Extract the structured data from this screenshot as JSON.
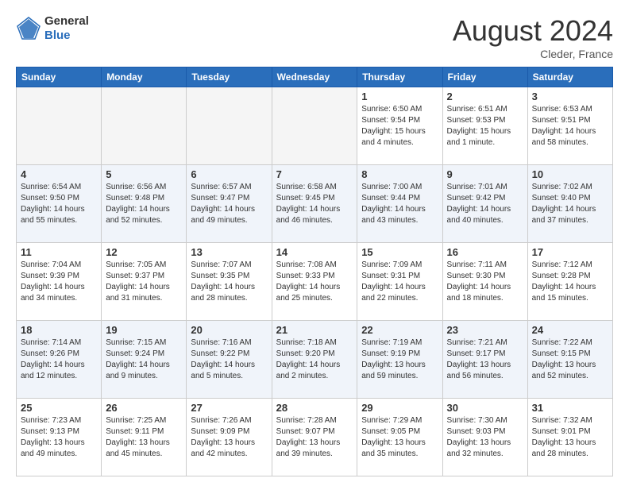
{
  "logo": {
    "general": "General",
    "blue": "Blue"
  },
  "title": "August 2024",
  "location": "Cleder, France",
  "days_of_week": [
    "Sunday",
    "Monday",
    "Tuesday",
    "Wednesday",
    "Thursday",
    "Friday",
    "Saturday"
  ],
  "weeks": [
    [
      {
        "day": "",
        "info": ""
      },
      {
        "day": "",
        "info": ""
      },
      {
        "day": "",
        "info": ""
      },
      {
        "day": "",
        "info": ""
      },
      {
        "day": "1",
        "info": "Sunrise: 6:50 AM\nSunset: 9:54 PM\nDaylight: 15 hours and 4 minutes."
      },
      {
        "day": "2",
        "info": "Sunrise: 6:51 AM\nSunset: 9:53 PM\nDaylight: 15 hours and 1 minute."
      },
      {
        "day": "3",
        "info": "Sunrise: 6:53 AM\nSunset: 9:51 PM\nDaylight: 14 hours and 58 minutes."
      }
    ],
    [
      {
        "day": "4",
        "info": "Sunrise: 6:54 AM\nSunset: 9:50 PM\nDaylight: 14 hours and 55 minutes."
      },
      {
        "day": "5",
        "info": "Sunrise: 6:56 AM\nSunset: 9:48 PM\nDaylight: 14 hours and 52 minutes."
      },
      {
        "day": "6",
        "info": "Sunrise: 6:57 AM\nSunset: 9:47 PM\nDaylight: 14 hours and 49 minutes."
      },
      {
        "day": "7",
        "info": "Sunrise: 6:58 AM\nSunset: 9:45 PM\nDaylight: 14 hours and 46 minutes."
      },
      {
        "day": "8",
        "info": "Sunrise: 7:00 AM\nSunset: 9:44 PM\nDaylight: 14 hours and 43 minutes."
      },
      {
        "day": "9",
        "info": "Sunrise: 7:01 AM\nSunset: 9:42 PM\nDaylight: 14 hours and 40 minutes."
      },
      {
        "day": "10",
        "info": "Sunrise: 7:02 AM\nSunset: 9:40 PM\nDaylight: 14 hours and 37 minutes."
      }
    ],
    [
      {
        "day": "11",
        "info": "Sunrise: 7:04 AM\nSunset: 9:39 PM\nDaylight: 14 hours and 34 minutes."
      },
      {
        "day": "12",
        "info": "Sunrise: 7:05 AM\nSunset: 9:37 PM\nDaylight: 14 hours and 31 minutes."
      },
      {
        "day": "13",
        "info": "Sunrise: 7:07 AM\nSunset: 9:35 PM\nDaylight: 14 hours and 28 minutes."
      },
      {
        "day": "14",
        "info": "Sunrise: 7:08 AM\nSunset: 9:33 PM\nDaylight: 14 hours and 25 minutes."
      },
      {
        "day": "15",
        "info": "Sunrise: 7:09 AM\nSunset: 9:31 PM\nDaylight: 14 hours and 22 minutes."
      },
      {
        "day": "16",
        "info": "Sunrise: 7:11 AM\nSunset: 9:30 PM\nDaylight: 14 hours and 18 minutes."
      },
      {
        "day": "17",
        "info": "Sunrise: 7:12 AM\nSunset: 9:28 PM\nDaylight: 14 hours and 15 minutes."
      }
    ],
    [
      {
        "day": "18",
        "info": "Sunrise: 7:14 AM\nSunset: 9:26 PM\nDaylight: 14 hours and 12 minutes."
      },
      {
        "day": "19",
        "info": "Sunrise: 7:15 AM\nSunset: 9:24 PM\nDaylight: 14 hours and 9 minutes."
      },
      {
        "day": "20",
        "info": "Sunrise: 7:16 AM\nSunset: 9:22 PM\nDaylight: 14 hours and 5 minutes."
      },
      {
        "day": "21",
        "info": "Sunrise: 7:18 AM\nSunset: 9:20 PM\nDaylight: 14 hours and 2 minutes."
      },
      {
        "day": "22",
        "info": "Sunrise: 7:19 AM\nSunset: 9:19 PM\nDaylight: 13 hours and 59 minutes."
      },
      {
        "day": "23",
        "info": "Sunrise: 7:21 AM\nSunset: 9:17 PM\nDaylight: 13 hours and 56 minutes."
      },
      {
        "day": "24",
        "info": "Sunrise: 7:22 AM\nSunset: 9:15 PM\nDaylight: 13 hours and 52 minutes."
      }
    ],
    [
      {
        "day": "25",
        "info": "Sunrise: 7:23 AM\nSunset: 9:13 PM\nDaylight: 13 hours and 49 minutes."
      },
      {
        "day": "26",
        "info": "Sunrise: 7:25 AM\nSunset: 9:11 PM\nDaylight: 13 hours and 45 minutes."
      },
      {
        "day": "27",
        "info": "Sunrise: 7:26 AM\nSunset: 9:09 PM\nDaylight: 13 hours and 42 minutes."
      },
      {
        "day": "28",
        "info": "Sunrise: 7:28 AM\nSunset: 9:07 PM\nDaylight: 13 hours and 39 minutes."
      },
      {
        "day": "29",
        "info": "Sunrise: 7:29 AM\nSunset: 9:05 PM\nDaylight: 13 hours and 35 minutes."
      },
      {
        "day": "30",
        "info": "Sunrise: 7:30 AM\nSunset: 9:03 PM\nDaylight: 13 hours and 32 minutes."
      },
      {
        "day": "31",
        "info": "Sunrise: 7:32 AM\nSunset: 9:01 PM\nDaylight: 13 hours and 28 minutes."
      }
    ]
  ]
}
